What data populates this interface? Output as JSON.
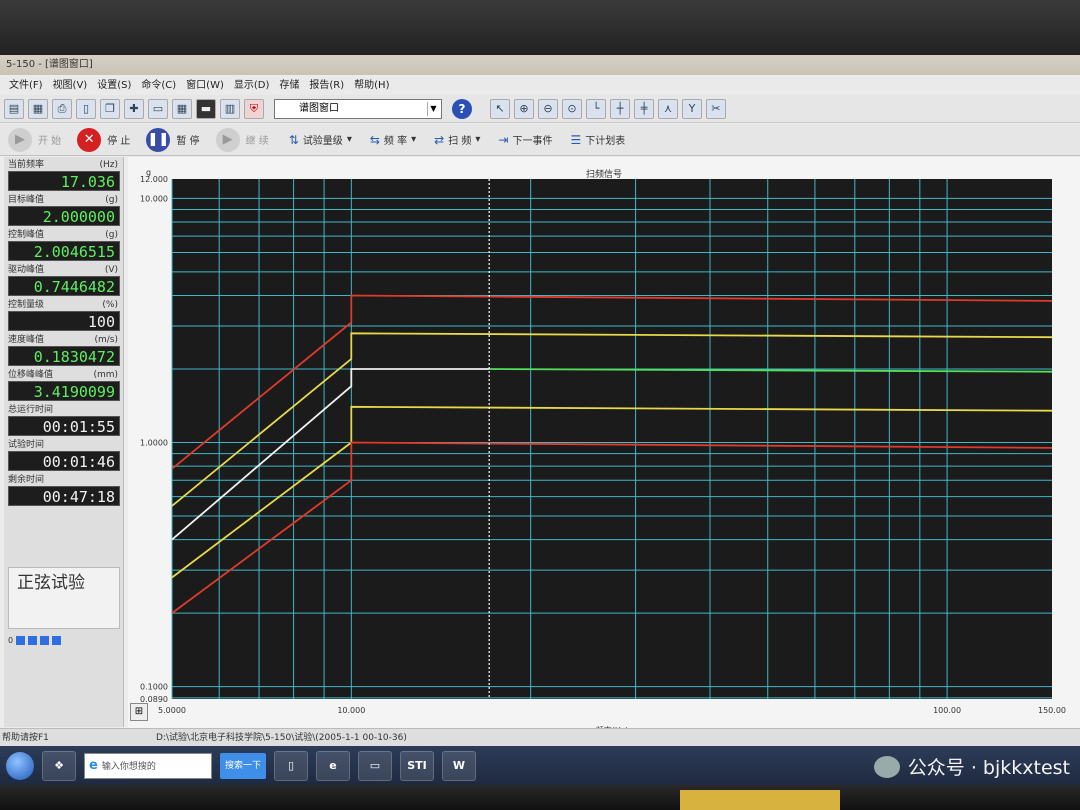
{
  "window": {
    "title": "5-150 - [谱图窗口]"
  },
  "menu": [
    "文件(F)",
    "视图(V)",
    "设置(S)",
    "命令(C)",
    "窗口(W)",
    "显示(D)",
    "存储",
    "报告(R)",
    "帮助(H)"
  ],
  "toolbar": {
    "window_select": "谱图窗口",
    "help_icon": "?"
  },
  "controls": {
    "start": "开 始",
    "stop": "停 止",
    "pause": "暂 停",
    "resume": "继 续",
    "level": "试验量级",
    "frequency": "频 率",
    "sweep": "扫 频",
    "next_event": "下一事件",
    "next_plan": "下计划表"
  },
  "stats": [
    {
      "label": "当前频率",
      "unit": "(Hz)",
      "value": "17.036",
      "color": "green"
    },
    {
      "label": "目标峰值",
      "unit": "(g)",
      "value": "2.000000",
      "color": "green"
    },
    {
      "label": "控制峰值",
      "unit": "(g)",
      "value": "2.0046515",
      "color": "green"
    },
    {
      "label": "驱动峰值",
      "unit": "(V)",
      "value": "0.7446482",
      "color": "green"
    },
    {
      "label": "控制量级",
      "unit": "(%)",
      "value": "100",
      "color": "white"
    },
    {
      "label": "速度峰值",
      "unit": "(m/s)",
      "value": "0.1830472",
      "color": "green"
    },
    {
      "label": "位移峰峰值",
      "unit": "(mm)",
      "value": "3.4190099",
      "color": "green"
    },
    {
      "label": "总运行时间",
      "unit": "",
      "value": "00:01:55",
      "color": "white"
    },
    {
      "label": "试验时间",
      "unit": "",
      "value": "00:01:46",
      "color": "white"
    },
    {
      "label": "剩余时间",
      "unit": "",
      "value": "00:47:18",
      "color": "white"
    }
  ],
  "test_type": "正弦试验",
  "progress_label": "0",
  "status": {
    "help": "帮助请按F1",
    "path": "D:\\试验\\北京电子科技学院\\5-150\\试验\\(2005-1-1 00-10-36)"
  },
  "taskbar": {
    "search_placeholder": "输入你想搜的",
    "search_button": "搜索一下",
    "app1": "STI",
    "app2": "W"
  },
  "watermark": "公众号 · bjkkxtest",
  "chart_data": {
    "type": "line",
    "title": "扫频信号",
    "xlabel": "频率(Hz)",
    "ylabel": "g",
    "x_scale": "log",
    "y_scale": "log",
    "xlim": [
      5.0,
      150.0
    ],
    "ylim": [
      0.089,
      12.0
    ],
    "x_tick_labels": [
      {
        "value": 5.0,
        "label": "5.0000"
      },
      {
        "value": 10.0,
        "label": "10.000"
      },
      {
        "value": 100.0,
        "label": "100.00"
      },
      {
        "value": 150.0,
        "label": "150.00"
      }
    ],
    "y_tick_labels": [
      {
        "value": 12.0,
        "label": "12.000"
      },
      {
        "value": 10.0,
        "label": "10.000"
      },
      {
        "value": 1.0,
        "label": "1.0000"
      },
      {
        "value": 0.1,
        "label": "0.1000"
      },
      {
        "value": 0.089,
        "label": "0.0890"
      }
    ],
    "grid": true,
    "background": "#1b1b1b",
    "grid_color": "#3fb8c9",
    "cursor_x": 17.036,
    "series": [
      {
        "color": "#e03a2a",
        "points": [
          [
            5.0,
            0.78
          ],
          [
            10.0,
            3.1
          ],
          [
            10.0,
            4.0
          ],
          [
            150.0,
            3.8
          ]
        ]
      },
      {
        "color": "#e8d84a",
        "points": [
          [
            5.0,
            0.55
          ],
          [
            10.0,
            2.2
          ],
          [
            10.0,
            2.8
          ],
          [
            150.0,
            2.7
          ]
        ]
      },
      {
        "color": "#f0f0f0",
        "points": [
          [
            5.0,
            0.4
          ],
          [
            10.0,
            1.7
          ],
          [
            10.0,
            2.0
          ],
          [
            17.036,
            2.0
          ]
        ]
      },
      {
        "color": "#52e05a",
        "points": [
          [
            17.036,
            2.0
          ],
          [
            150.0,
            1.95
          ]
        ]
      },
      {
        "color": "#e8d84a",
        "points": [
          [
            5.0,
            0.28
          ],
          [
            10.0,
            1.0
          ],
          [
            10.0,
            1.4
          ],
          [
            150.0,
            1.35
          ]
        ]
      },
      {
        "color": "#e03a2a",
        "points": [
          [
            5.0,
            0.2
          ],
          [
            10.0,
            0.7
          ],
          [
            10.0,
            1.0
          ],
          [
            150.0,
            0.95
          ]
        ]
      }
    ]
  }
}
